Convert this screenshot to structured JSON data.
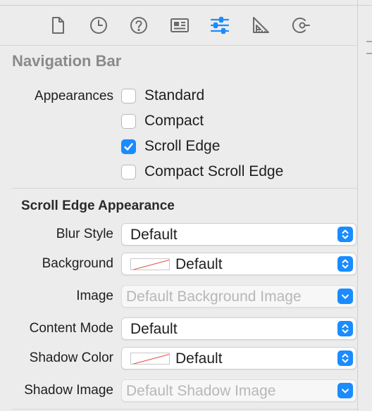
{
  "toolbar": {
    "tabs": [
      {
        "icon": "file-inspector-icon"
      },
      {
        "icon": "history-inspector-icon"
      },
      {
        "icon": "quick-help-icon"
      },
      {
        "icon": "identity-inspector-icon"
      },
      {
        "icon": "attributes-inspector-icon",
        "selected": true
      },
      {
        "icon": "size-inspector-icon"
      },
      {
        "icon": "connections-inspector-icon"
      }
    ]
  },
  "colors": {
    "accent": "#1a8cff",
    "icon": "#6b6b6b",
    "title": "#8a8a8a",
    "swatch_slash": "#e8433a"
  },
  "section": {
    "title": "Navigation Bar"
  },
  "appearances": {
    "label": "Appearances",
    "options": [
      {
        "label": "Standard",
        "checked": false
      },
      {
        "label": "Compact",
        "checked": false
      },
      {
        "label": "Scroll Edge",
        "checked": true
      },
      {
        "label": "Compact Scroll Edge",
        "checked": false
      }
    ]
  },
  "scroll_edge": {
    "title": "Scroll Edge Appearance",
    "blur_style": {
      "label": "Blur Style",
      "value": "Default"
    },
    "background": {
      "label": "Background",
      "value": "Default"
    },
    "image": {
      "label": "Image",
      "placeholder": "Default Background Image"
    },
    "content_mode": {
      "label": "Content Mode",
      "value": "Default"
    },
    "shadow_color": {
      "label": "Shadow Color",
      "value": "Default"
    },
    "shadow_image": {
      "label": "Shadow Image",
      "placeholder": "Default Shadow Image"
    }
  }
}
